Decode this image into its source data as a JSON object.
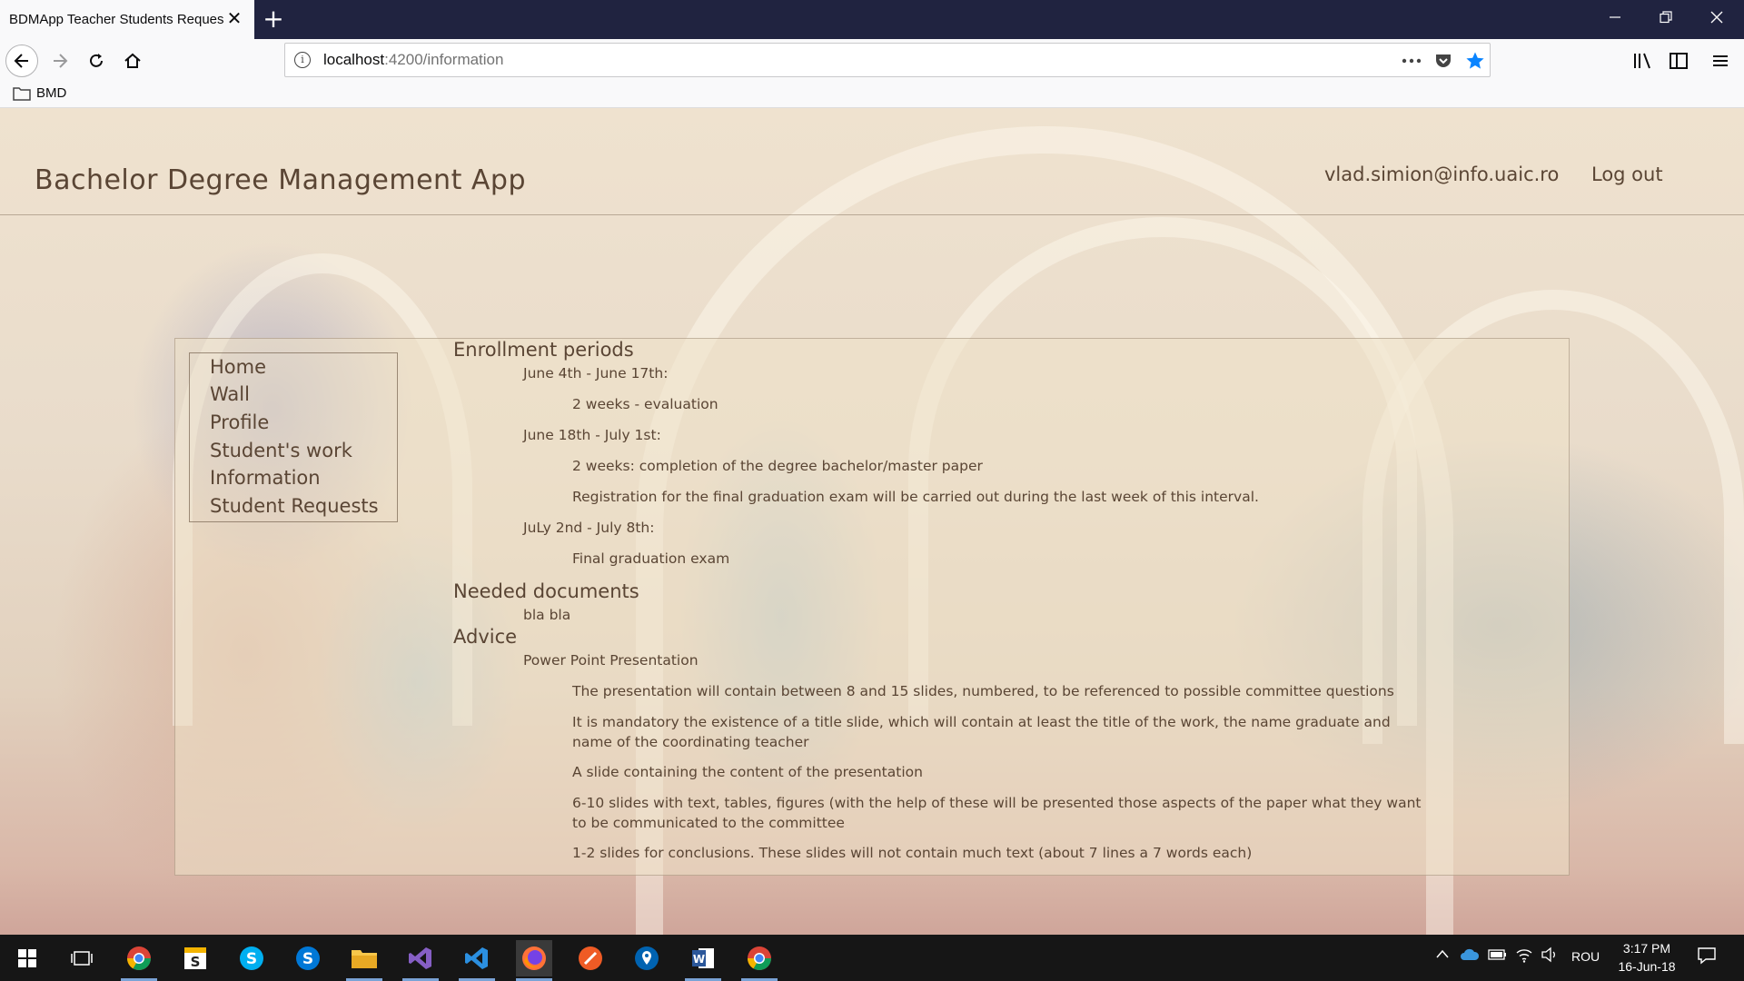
{
  "browser": {
    "tab_title": "BDMApp Teacher Students Requests",
    "tab_close": "✕",
    "new_tab": "+",
    "url_host": "localhost",
    "url_path": ":4200/information",
    "bookmark_folder": "BMD"
  },
  "header": {
    "app_title": "Bachelor Degree Management App",
    "user_email": "vlad.simion@info.uaic.ro",
    "logout": "Log out"
  },
  "menu": {
    "items": [
      {
        "label": "Home"
      },
      {
        "label": "Wall"
      },
      {
        "label": "Profile"
      },
      {
        "label": "Student's work"
      },
      {
        "label": "Information"
      },
      {
        "label": "Student Requests"
      }
    ]
  },
  "content": {
    "enrollment": {
      "title": "Enrollment periods",
      "p1_label": "June 4th - June 17th:",
      "p1_items": [
        "2 weeks - evaluation"
      ],
      "p2_label": "June 18th - July 1st:",
      "p2_items": [
        "2 weeks: completion of the degree bachelor/master paper",
        "Registration for the final graduation exam will be carried out during the last week of this interval."
      ],
      "p3_label": "JuLy 2nd - July 8th:",
      "p3_items": [
        "Final graduation exam"
      ]
    },
    "documents": {
      "title": "Needed documents",
      "text": "bla bla"
    },
    "advice": {
      "title": "Advice",
      "sub": "Power Point Presentation",
      "items": [
        "The presentation will contain between 8 and 15 slides, numbered, to be referenced to possible committee questions",
        "It is mandatory the existence of a title slide, which will contain at least the title of the work, the name graduate and name of the coordinating teacher",
        "A slide containing the content of the presentation",
        "6-10 slides with text, tables, figures (with the help of these will be presented those aspects of the paper what they want to be communicated to the committee",
        "1-2 slides for conclusions. These slides will not contain much text (about 7 lines a 7 words each)"
      ]
    }
  },
  "taskbar": {
    "language": "ROU",
    "time": "3:17 PM",
    "date": "16-Jun-18"
  },
  "colors": {
    "text": "#5a4534",
    "titlebar": "#202340",
    "taskbar": "#161616"
  }
}
